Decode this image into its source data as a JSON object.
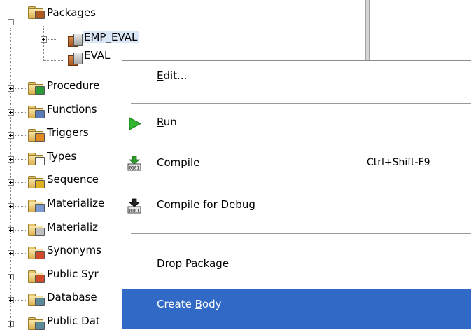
{
  "tree": {
    "packages_label": "Packages",
    "emp_eval_label": "EMP_EVAL",
    "eval_label": "EVAL",
    "nodes": [
      {
        "label": "Procedure",
        "icon": "procedure-folder-icon",
        "badge": "#2a9a3a"
      },
      {
        "label": "Functions",
        "icon": "function-folder-icon",
        "badge": "#5a7ab8"
      },
      {
        "label": "Triggers",
        "icon": "trigger-folder-icon",
        "badge": "#e08a20"
      },
      {
        "label": "Types",
        "icon": "type-folder-icon",
        "badge": "#ffffff"
      },
      {
        "label": "Sequence",
        "icon": "sequence-folder-icon",
        "badge": "#e0b020"
      },
      {
        "label": "Materialize",
        "icon": "materialized-view-folder-icon",
        "badge": "#7a9ad0"
      },
      {
        "label": "Materializ",
        "icon": "materialized-log-folder-icon",
        "badge": "#c0c0c0"
      },
      {
        "label": "Synonyms",
        "icon": "synonym-folder-icon",
        "badge": "#d04a2a"
      },
      {
        "label": "Public Syr",
        "icon": "public-synonym-folder-icon",
        "badge": "#d04a2a"
      },
      {
        "label": "Database",
        "icon": "database-link-folder-icon",
        "badge": "#5a8a9a"
      },
      {
        "label": "Public Dat",
        "icon": "public-database-link-folder-icon",
        "badge": "#5a8a9a"
      }
    ]
  },
  "menu": {
    "edit": {
      "before": "",
      "key": "E",
      "after": "dit..."
    },
    "run": {
      "before": "",
      "key": "R",
      "after": "un"
    },
    "compile": {
      "before": "",
      "key": "C",
      "after": "ompile",
      "shortcut": "Ctrl+Shift-F9"
    },
    "compile_debug": {
      "before": "Compile ",
      "key": "f",
      "after": "or Debug"
    },
    "drop_package": {
      "before": "",
      "key": "D",
      "after": "rop Package"
    },
    "create_body": {
      "before": "Create ",
      "key": "B",
      "after": "ody"
    }
  },
  "colors": {
    "highlight": "#3169c6",
    "selection": "#dbe7f7"
  }
}
